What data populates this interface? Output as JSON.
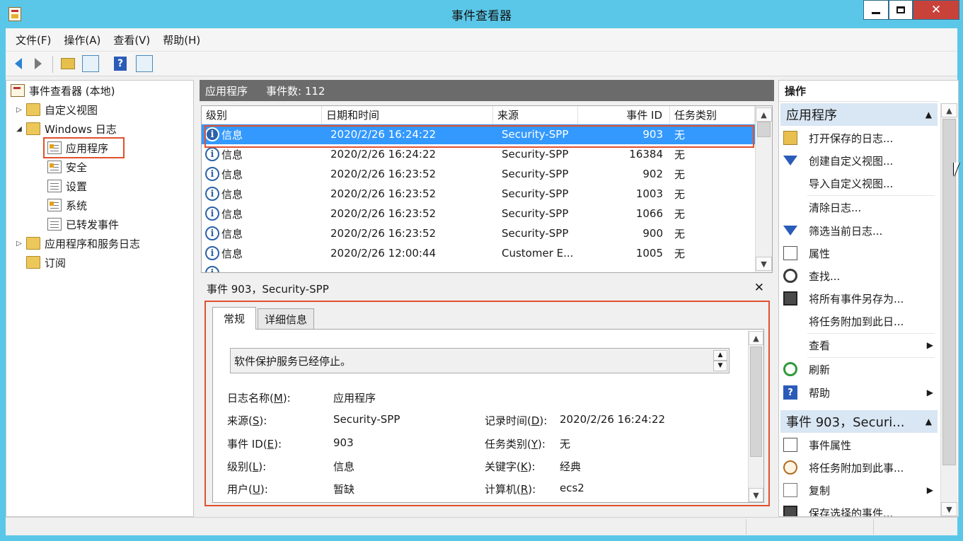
{
  "window": {
    "title": "事件查看器"
  },
  "menu": [
    "文件(F)",
    "操作(A)",
    "查看(V)",
    "帮助(H)"
  ],
  "toolbar": {
    "help_label": "?"
  },
  "tree": {
    "root": "事件查看器 (本地)",
    "custom_views": "自定义视图",
    "windows_logs": "Windows 日志",
    "application": "应用程序",
    "security": "安全",
    "setup": "设置",
    "system": "系统",
    "forwarded": "已转发事件",
    "app_service_logs": "应用程序和服务日志",
    "subscriptions": "订阅"
  },
  "list": {
    "title": "应用程序",
    "count_label": "事件数: 112",
    "columns": [
      "级别",
      "日期和时间",
      "来源",
      "事件 ID",
      "任务类别"
    ],
    "rows": [
      {
        "level": "信息",
        "datetime": "2020/2/26 16:24:22",
        "source": "Security-SPP",
        "id": "903",
        "task": "无"
      },
      {
        "level": "信息",
        "datetime": "2020/2/26 16:24:22",
        "source": "Security-SPP",
        "id": "16384",
        "task": "无"
      },
      {
        "level": "信息",
        "datetime": "2020/2/26 16:23:52",
        "source": "Security-SPP",
        "id": "902",
        "task": "无"
      },
      {
        "level": "信息",
        "datetime": "2020/2/26 16:23:52",
        "source": "Security-SPP",
        "id": "1003",
        "task": "无"
      },
      {
        "level": "信息",
        "datetime": "2020/2/26 16:23:52",
        "source": "Security-SPP",
        "id": "1066",
        "task": "无"
      },
      {
        "level": "信息",
        "datetime": "2020/2/26 16:23:52",
        "source": "Security-SPP",
        "id": "900",
        "task": "无"
      },
      {
        "level": "信息",
        "datetime": "2020/2/26 12:00:44",
        "source": "Customer E...",
        "id": "1005",
        "task": "无"
      }
    ]
  },
  "details": {
    "title": "事件 903，Security-SPP",
    "tabs": [
      "常规",
      "详细信息"
    ],
    "description": "软件保护服务已经停止。",
    "log_name_label": "日志名称(",
    "log_name_key": "M",
    "log_name_value": "应用程序",
    "source_label": "来源(",
    "source_key": "S",
    "source_value": "Security-SPP",
    "logged_label": "记录时间(",
    "logged_key": "D",
    "logged_value": "2020/2/26 16:24:22",
    "event_id_label": "事件 ID(",
    "event_id_key": "E",
    "event_id_value": "903",
    "task_label": "任务类别(",
    "task_key": "Y",
    "task_value": "无",
    "level_label": "级别(",
    "level_key": "L",
    "level_value": "信息",
    "keywords_label": "关键字(",
    "keywords_key": "K",
    "keywords_value": "经典",
    "user_label": "用户(",
    "user_key": "U",
    "user_value": "暂缺",
    "computer_label": "计算机(",
    "computer_key": "R",
    "computer_value": "ecs2",
    "close_glyph": "✕"
  },
  "actions": {
    "title": "操作",
    "section1": "应用程序",
    "items1": [
      "打开保存的日志...",
      "创建自定义视图...",
      "导入自定义视图...",
      "清除日志...",
      "筛选当前日志...",
      "属性",
      "查找...",
      "将所有事件另存为...",
      "将任务附加到此日...",
      "查看",
      "刷新",
      "帮助"
    ],
    "section2": "事件 903，Securi...",
    "items2": [
      "事件属性",
      "将任务附加到此事...",
      "复制",
      "保存选择的事件..."
    ]
  }
}
